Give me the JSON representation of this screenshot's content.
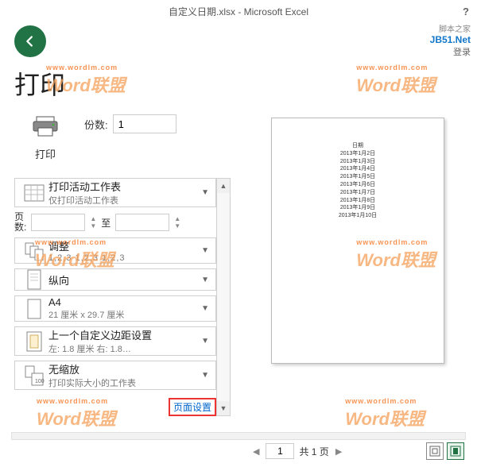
{
  "titlebar": {
    "title": "自定义日期.xlsx - Microsoft Excel",
    "help": "?"
  },
  "topright": {
    "jb": "JB51.Net",
    "sub": "脚本之家",
    "login": "登录"
  },
  "back_label": "返回",
  "page_title": "打印",
  "print_button": {
    "label": "打印"
  },
  "copies": {
    "label": "份数:",
    "value": "1"
  },
  "settings": {
    "print_what": {
      "title": "打印活动工作表",
      "sub": "仅打印活动工作表"
    },
    "page_range": {
      "label_pages": "页",
      "label_count": "数:",
      "to": "至"
    },
    "collation": {
      "title": "调整",
      "seq": "1,2,3   1,2,3   1,2,3"
    },
    "orientation": {
      "title": "纵向"
    },
    "paper": {
      "title": "A4",
      "sub": "21 厘米 x 29.7 厘米"
    },
    "margins": {
      "title": "上一个自定义边距设置",
      "sub": "左: 1.8 厘米  右: 1.8…"
    },
    "scaling": {
      "title": "无缩放",
      "sub": "打印实际大小的工作表"
    }
  },
  "page_setup_link": "页面设置",
  "preview": {
    "nav": {
      "current": "1",
      "total_label": "共 1 页"
    },
    "rows": [
      "日期",
      "2013年1月2日",
      "2013年1月3日",
      "2013年1月4日",
      "2013年1月5日",
      "2013年1月6日",
      "2013年1月7日",
      "2013年1月8日",
      "2013年1月9日",
      "2013年1月10日"
    ]
  },
  "watermark": {
    "text": "Word联盟",
    "mini": "www.wordlm.com"
  }
}
